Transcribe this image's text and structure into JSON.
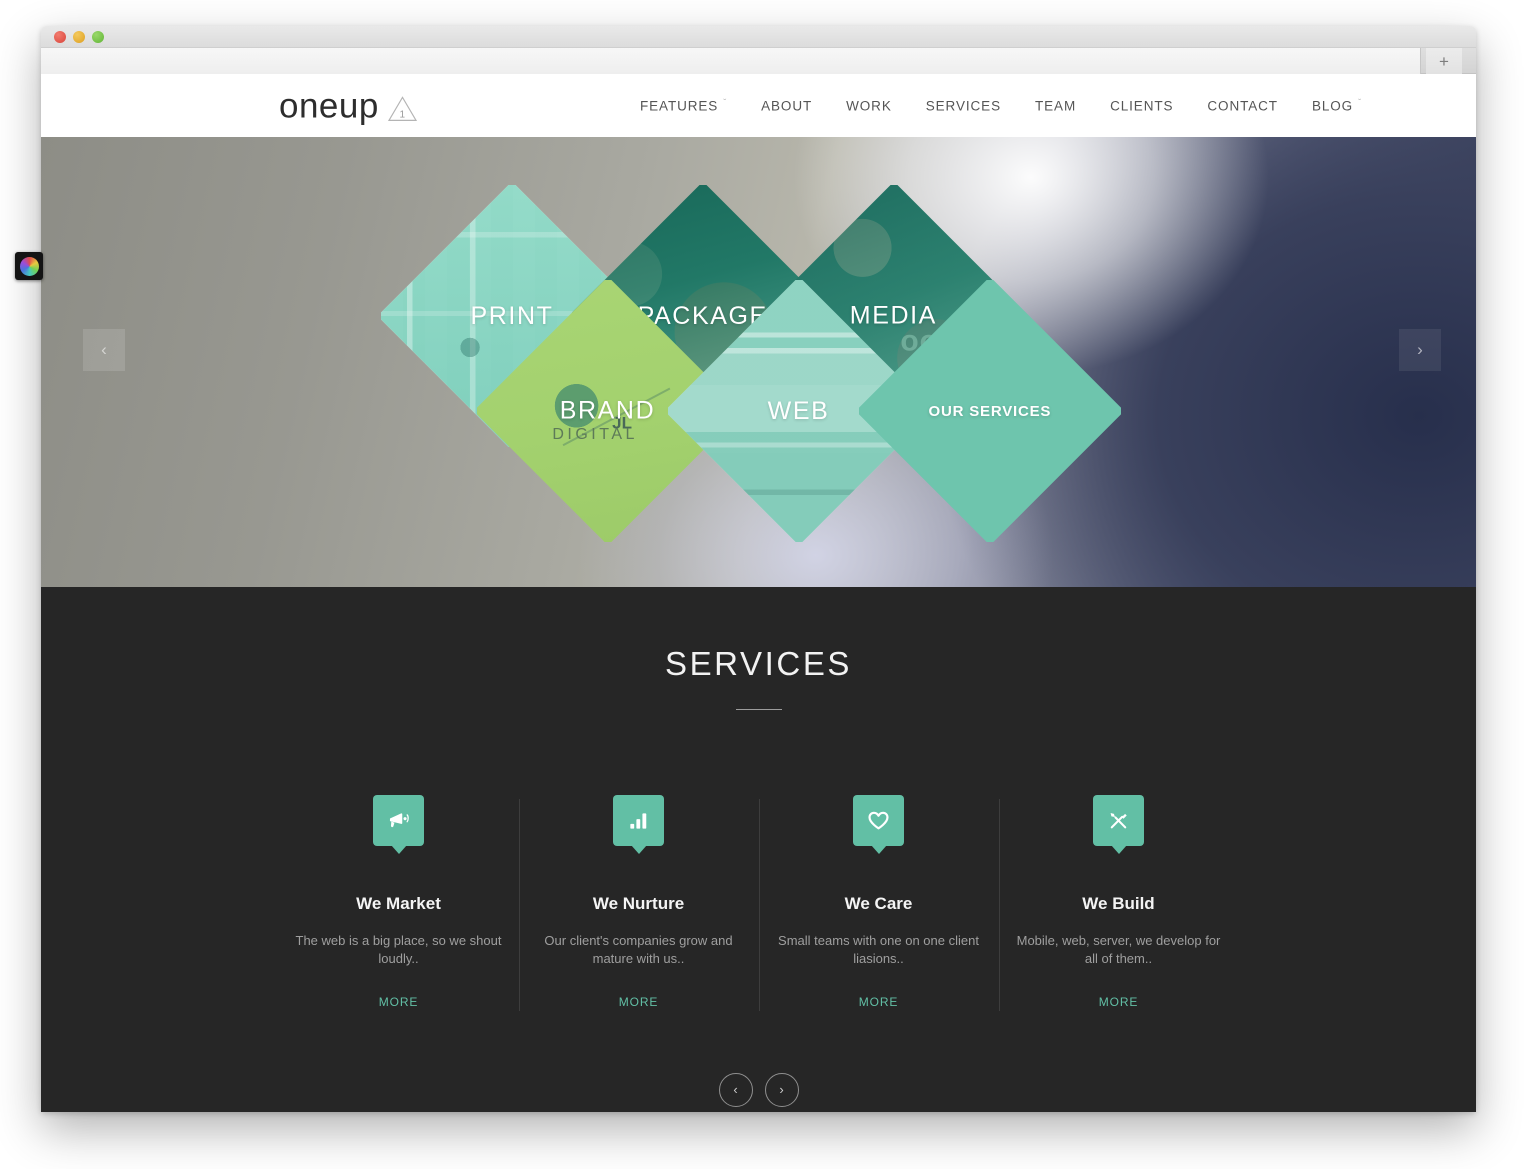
{
  "browser": {
    "traffic_lights": [
      "close",
      "minimize",
      "maximize"
    ],
    "new_tab_label": "+"
  },
  "site": {
    "logo": {
      "word": "oneup",
      "badge_number": "1",
      "badge_icon": "triangle-one-icon"
    },
    "nav": [
      {
        "label": "FEATURES",
        "caret": "ˇ"
      },
      {
        "label": "ABOUT",
        "caret": ""
      },
      {
        "label": "WORK",
        "caret": ""
      },
      {
        "label": "SERVICES",
        "caret": ""
      },
      {
        "label": "TEAM",
        "caret": ""
      },
      {
        "label": "CLIENTS",
        "caret": ""
      },
      {
        "label": "CONTACT",
        "caret": ""
      },
      {
        "label": "BLOG",
        "caret": "ˇ"
      }
    ]
  },
  "hero": {
    "prev_arrow": "‹",
    "next_arrow": "›",
    "tiles": [
      {
        "label": "PRINT",
        "style": "mint-print",
        "accent": "#78cdb9"
      },
      {
        "label": "PACKAGE",
        "style": "teal-package",
        "accent": "#1d6b5c"
      },
      {
        "label": "MEDIA",
        "style": "teal-media",
        "accent": "#2c7a68"
      },
      {
        "label": "BRAND",
        "style": "lime-brand",
        "accent": "#a9d574"
      },
      {
        "label": "WEB",
        "style": "mint-web",
        "accent": "#80cebb"
      },
      {
        "label": "OUR SERVICES",
        "style": "solid-mint",
        "accent": "#6ec5ad"
      }
    ],
    "brand_tile_marks": {
      "digital": "DIGITAL",
      "jl": "JL"
    },
    "media_tile_mark": "oo"
  },
  "services": {
    "title": "SERVICES",
    "cards": [
      {
        "icon": "megaphone-icon",
        "title": "We Market",
        "desc": "The web is a big place, so we shout loudly..",
        "more": "MORE"
      },
      {
        "icon": "bar-chart-icon",
        "title": "We Nurture",
        "desc": "Our client's companies grow and mature with us..",
        "more": "MORE"
      },
      {
        "icon": "heart-icon",
        "title": "We Care",
        "desc": "Small teams with one on one client liasions..",
        "more": "MORE"
      },
      {
        "icon": "hammer-wrench-icon",
        "title": "We Build",
        "desc": "Mobile, web, server, we develop for all of them..",
        "more": "MORE"
      }
    ],
    "prev_arrow": "‹",
    "next_arrow": "›"
  },
  "overlay": {
    "color_picker_icon": "color-wheel-icon"
  },
  "colors": {
    "accent_mint": "#62bfa5",
    "accent_lime": "#a9d574",
    "dark_section": "#262626",
    "header_bg": "#ffffff"
  }
}
